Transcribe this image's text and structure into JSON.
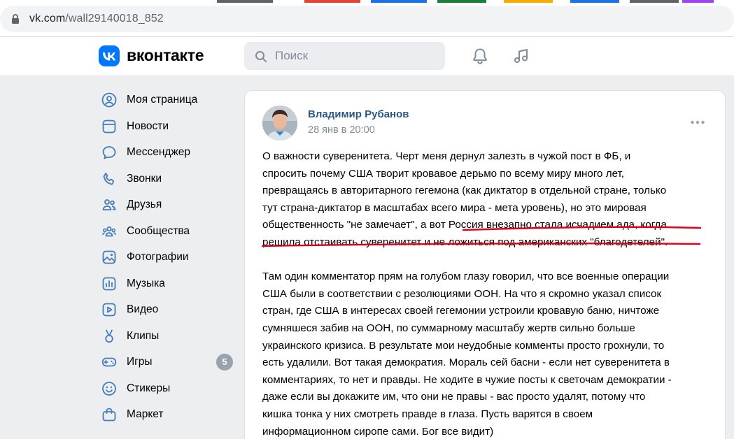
{
  "browser": {
    "url_host": "vk.com",
    "url_path": "/wall29140018_852"
  },
  "header": {
    "logo_text": "вконтакте",
    "search_placeholder": "Поиск"
  },
  "sidebar": {
    "items": [
      {
        "label": "Моя страница",
        "icon": "user-circle-icon"
      },
      {
        "label": "Новости",
        "icon": "news-icon"
      },
      {
        "label": "Мессенджер",
        "icon": "message-icon"
      },
      {
        "label": "Звонки",
        "icon": "phone-icon"
      },
      {
        "label": "Друзья",
        "icon": "friends-icon"
      },
      {
        "label": "Сообщества",
        "icon": "communities-icon"
      },
      {
        "label": "Фотографии",
        "icon": "photo-icon"
      },
      {
        "label": "Музыка",
        "icon": "music-note-icon"
      },
      {
        "label": "Видео",
        "icon": "video-icon"
      },
      {
        "label": "Клипы",
        "icon": "clips-icon"
      },
      {
        "label": "Игры",
        "icon": "gamepad-icon",
        "badge": "5"
      },
      {
        "label": "Стикеры",
        "icon": "smile-icon"
      },
      {
        "label": "Маркет",
        "icon": "market-bag-icon"
      }
    ]
  },
  "post": {
    "author": "Владимир Рубанов",
    "date": "28 янв в 20:00",
    "paragraphs": [
      "О важности суверенитета. Черт меня дернул залезть в чужой пост в ФБ, и\nспросить почему США творит кровавое дерьмо по всему миру много лет,\nпревращаясь в авторитарного гегемона (как диктатор в отдельной стране, только\nтут страна-диктатор в масштабах всего мира - мета уровень), но это мировая\nобщественность \"не замечает\", а вот Россия внезапно стала исчадием ада, когда\nрешила отстаивать суверенитет и не ложиться под американских \"благодетелей\".",
      "Там один комментатор прям на голубом глазу говорил, что все военные операции\nСША были в соответствии с резолюциями ООН. На что я скромно указал список\nстран, где США в интересах своей гегемонии устроили кровавую баню, ничтоже\nсумняшеся забив на ООН, по суммарному масштабу жертв сильно больше\nукраинского кризиса. В результате мои неудобные комменты просто грохнули, то\nесть удалили. Вот такая демократия. Мораль сей басни - если нет суверенитета в\nкомментариях, то нет и правды. Не ходите в чужие посты к светочам демократии -\nдаже если вы докажите им, что они не правы - вас просто удалят, потому что\nкишка тонка у них смотреть правде в глаза. Пусть варятся в своем\nинформационном сиропе сами. Бог все видит)"
    ]
  },
  "colors": {
    "accent": "#0077ff",
    "link": "#2a5885",
    "annotation": "#e1001e"
  }
}
